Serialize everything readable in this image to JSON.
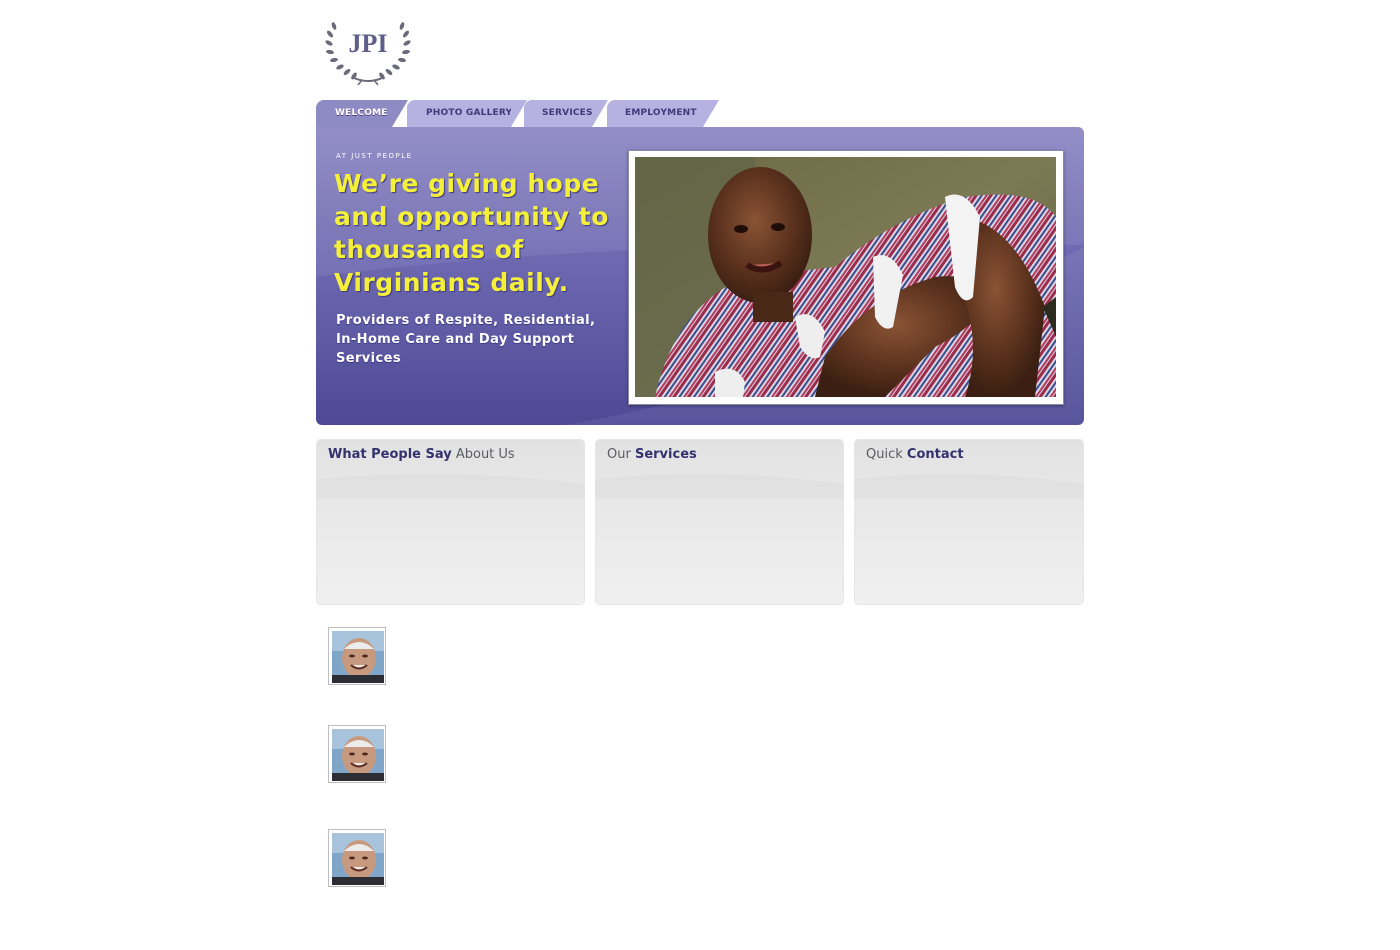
{
  "logo": {
    "text": "JPI",
    "icon": "laurel-wreath-icon"
  },
  "nav": {
    "tabs": [
      {
        "label": "WELCOME",
        "active": true
      },
      {
        "label": "PHOTO GALLERY",
        "active": false
      },
      {
        "label": "SERVICES",
        "active": false
      },
      {
        "label": "EMPLOYMENT",
        "active": false
      }
    ]
  },
  "hero": {
    "kicker": "AT JUST PEOPLE",
    "headline": "We’re giving hope and opportunity to thousands of Virginians daily.",
    "subheading": "Providers of Respite, Residential, In-Home Care and Day Support Services"
  },
  "boxes": {
    "testimonials": {
      "title_strong": "What People Say",
      "title_light": "About Us"
    },
    "services": {
      "title_light": "Our",
      "title_strong": "Services"
    },
    "contact": {
      "title_light": "Quick",
      "title_strong": "Contact"
    }
  },
  "colors": {
    "accent": "#6d68b0",
    "headline": "#f4f03a",
    "tab_active": "#8e8ac3",
    "tab_inactive": "#b5b1e0",
    "title_dark": "#34316e"
  }
}
